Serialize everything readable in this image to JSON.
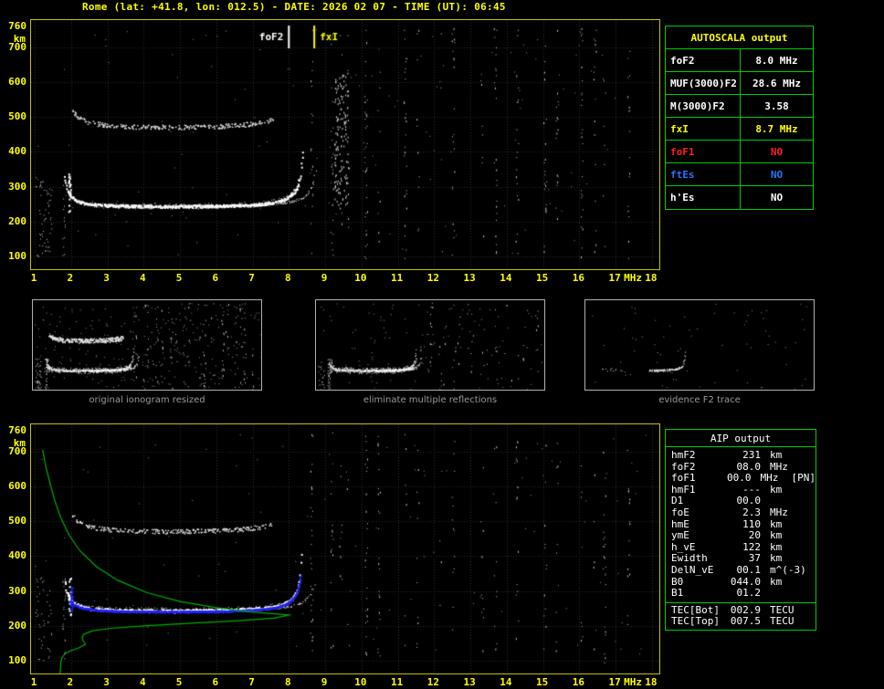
{
  "header": {
    "title": "Rome (lat: +41.8, lon: 012.5) - DATE: 2026 02 07 - TIME (UT): 06:45"
  },
  "axis": {
    "x_ticks": [
      "1",
      "2",
      "3",
      "4",
      "5",
      "6",
      "7",
      "8",
      "9",
      "10",
      "11",
      "12",
      "13",
      "14",
      "15",
      "16",
      "17",
      "18"
    ],
    "x_unit": "MHz",
    "y_ticks": [
      "760",
      "700",
      "600",
      "500",
      "400",
      "300",
      "200",
      "100"
    ],
    "y_unit": "km",
    "f_min": 1,
    "f_max": 18,
    "km_min": 100,
    "km_max": 760
  },
  "top_plot": {
    "markers": [
      {
        "label": "foF2",
        "f": 8.0,
        "color": "#ffffff",
        "side": "left"
      },
      {
        "label": "fxI",
        "f": 8.7,
        "color": "#ffff00",
        "side": "right"
      }
    ]
  },
  "panels": [
    {
      "caption": "original ionogram resized"
    },
    {
      "caption": "eliminate multiple reflections"
    },
    {
      "caption": "evidence F2 trace"
    }
  ],
  "autoscala": {
    "title": "AUTOSCALA output",
    "rows": [
      {
        "label": "foF2",
        "value": "8.0 MHz",
        "color": "#ffffff"
      },
      {
        "label": "MUF(3000)F2",
        "value": "28.6 MHz",
        "color": "#ffffff"
      },
      {
        "label": "M(3000)F2",
        "value": "3.58",
        "color": "#ffffff"
      },
      {
        "label": "fxI",
        "value": "8.7 MHz",
        "color": "#ffff00"
      },
      {
        "label": "foF1",
        "value": "NO",
        "color": "#ff2020"
      },
      {
        "label": "ftEs",
        "value": "NO",
        "color": "#2277ff"
      },
      {
        "label": "h'Es",
        "value": "NO",
        "color": "#ffffff"
      }
    ]
  },
  "aip": {
    "title": "AIP output",
    "rows": [
      {
        "name": "hmF2",
        "value": "231",
        "unit": "km",
        "note": ""
      },
      {
        "name": "foF2",
        "value": "08.0",
        "unit": "MHz",
        "note": ""
      },
      {
        "name": "foF1",
        "value": "00.0",
        "unit": "MHz",
        "note": "[PN]"
      },
      {
        "name": "hmF1",
        "value": "---",
        "unit": "km",
        "note": ""
      },
      {
        "name": "D1",
        "value": "00.0",
        "unit": "",
        "note": ""
      },
      {
        "name": "foE",
        "value": "2.3",
        "unit": "MHz",
        "note": ""
      },
      {
        "name": "hmE",
        "value": "110",
        "unit": "km",
        "note": ""
      },
      {
        "name": "ymE",
        "value": "20",
        "unit": "km",
        "note": ""
      },
      {
        "name": "h_vE",
        "value": "122",
        "unit": "km",
        "note": ""
      },
      {
        "name": "Ewidth",
        "value": "37",
        "unit": "km",
        "note": ""
      },
      {
        "name": "DelN_vE",
        "value": "00.1",
        "unit": "m^(-3)",
        "note": ""
      },
      {
        "name": "B0",
        "value": "044.0",
        "unit": "km",
        "note": ""
      },
      {
        "name": "B1",
        "value": "01.2",
        "unit": "",
        "note": ""
      }
    ],
    "tec_rows": [
      {
        "name": "TEC[Bot]",
        "value": "002.9",
        "unit": "TECU"
      },
      {
        "name": "TEC[Top]",
        "value": "007.5",
        "unit": "TECU"
      }
    ]
  },
  "ionogram": {
    "foF2_MHz": 8.0,
    "fxI_MHz": 8.7,
    "hmF2_km": 231,
    "foE_MHz": 2.3,
    "noise_columns_f": [
      8.62,
      9.18,
      9.42,
      9.62,
      10.12,
      10.48,
      11.2,
      11.55,
      12.18,
      12.52,
      13.32,
      13.68,
      14.28,
      15.05,
      15.38,
      16.05,
      16.42,
      16.68,
      17.35
    ],
    "profile_points": [
      [
        1.22,
        705
      ],
      [
        1.3,
        660
      ],
      [
        1.42,
        610
      ],
      [
        1.55,
        560
      ],
      [
        1.72,
        510
      ],
      [
        1.95,
        460
      ],
      [
        2.25,
        415
      ],
      [
        2.7,
        370
      ],
      [
        3.3,
        330
      ],
      [
        4.1,
        295
      ],
      [
        5.0,
        270
      ],
      [
        6.0,
        252
      ],
      [
        7.0,
        240
      ],
      [
        7.7,
        234
      ],
      [
        8.0,
        231
      ],
      [
        7.6,
        222
      ],
      [
        6.5,
        214
      ],
      [
        5.2,
        207
      ],
      [
        4.0,
        200
      ],
      [
        3.1,
        193
      ],
      [
        2.6,
        186
      ],
      [
        2.35,
        176
      ],
      [
        2.3,
        165
      ],
      [
        2.35,
        155
      ],
      [
        2.4,
        147
      ],
      [
        2.2,
        136
      ],
      [
        1.95,
        127
      ],
      [
        1.82,
        118
      ],
      [
        1.75,
        108
      ],
      [
        1.72,
        95
      ],
      [
        1.7,
        62
      ]
    ],
    "seed": 1234567
  }
}
